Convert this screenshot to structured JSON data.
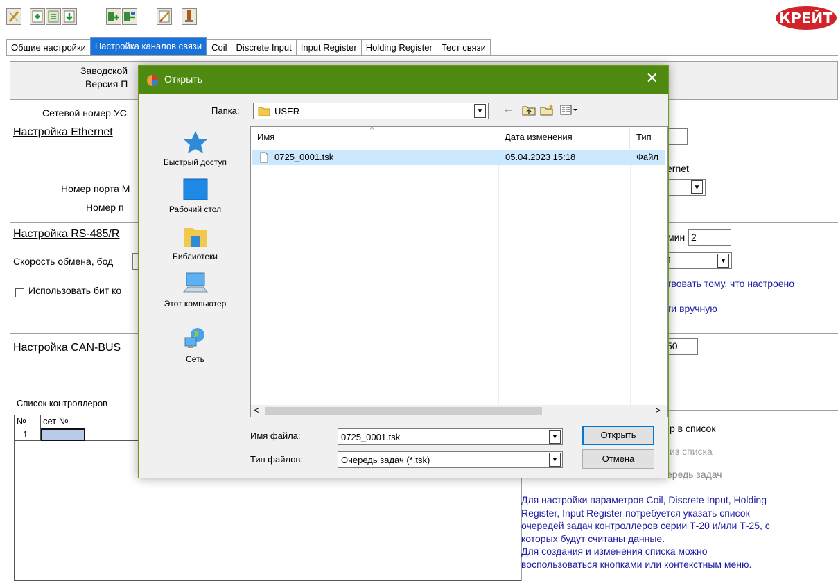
{
  "app": {
    "logo_text": "КРЕЙТ",
    "brand_color": "#d2232a",
    "toolbar_icons": [
      "pencil-icon",
      "add-icon",
      "edit-doc-icon",
      "import-icon",
      "export-in-icon",
      "export-out-icon",
      "write-icon",
      "flash-icon"
    ]
  },
  "tabs": [
    {
      "label": "Общие настройки",
      "active": false
    },
    {
      "label": "Настройка каналов связи",
      "active": true
    },
    {
      "label": "Coil",
      "active": false
    },
    {
      "label": "Discrete Input",
      "active": false
    },
    {
      "label": "Input Register",
      "active": false
    },
    {
      "label": "Holding Register",
      "active": false
    },
    {
      "label": "Тест связи",
      "active": false
    }
  ],
  "main": {
    "factory_label": "Заводской",
    "version_label": "Версия П",
    "network_number_label": "Сетевой номер УС",
    "ethernet_header": "Настройка Ethernet",
    "ethernet_right_label": "ernet",
    "port_label": "Номер порта М",
    "number_label": "Номер п",
    "rs485_header": "Настройка RS-485/R",
    "min_label": "мин",
    "min_value": "2",
    "speed_label": "Скорость обмена, бод",
    "combo_value": "1",
    "use_bit_label": "Использовать бит ко",
    "match_text": "твовать тому, что настроено",
    "manual_text": "ти вручную",
    "can_header": "Настройка CAN-BUS",
    "can_value": "50",
    "controllers_list_title": "Список контроллеров",
    "grid": {
      "headers": [
        "№",
        "сет №"
      ],
      "rows": [
        [
          "1",
          ""
        ]
      ]
    },
    "add_to_list_text": "р в список",
    "remove_from_list_text": "из списка",
    "queue_text": "ередь задач",
    "info_lines": [
      "Для настройки параметров Coil, Discrete Input, Holding",
      "Register, Input Register потребуется указать список",
      "очередей задач контроллеров серии Т-20 и/или Т-25, с",
      "которых будут считаны данные.",
      "Для создания и изменения списка можно",
      "воспользоваться кнопками или контекстным меню."
    ]
  },
  "dialog": {
    "title": "Открыть",
    "close_glyph": "✕",
    "folder_label": "Папка:",
    "folder_value": "USER",
    "places": [
      "Быстрый доступ",
      "Рабочий стол",
      "Библиотеки",
      "Этот компьютер",
      "Сеть"
    ],
    "columns": [
      "Имя",
      "Дата изменения",
      "Тип"
    ],
    "files": [
      {
        "name": "0725_0001.tsk",
        "date": "05.04.2023 15:18",
        "type": "Файл"
      }
    ],
    "filename_label": "Имя файла:",
    "filename_value": "0725_0001.tsk",
    "filetype_label": "Тип файлов:",
    "filetype_value": "Очередь задач (*.tsk)",
    "open_button": "Открыть",
    "cancel_button": "Отмена",
    "title_bar_color": "#4e8a0f"
  }
}
